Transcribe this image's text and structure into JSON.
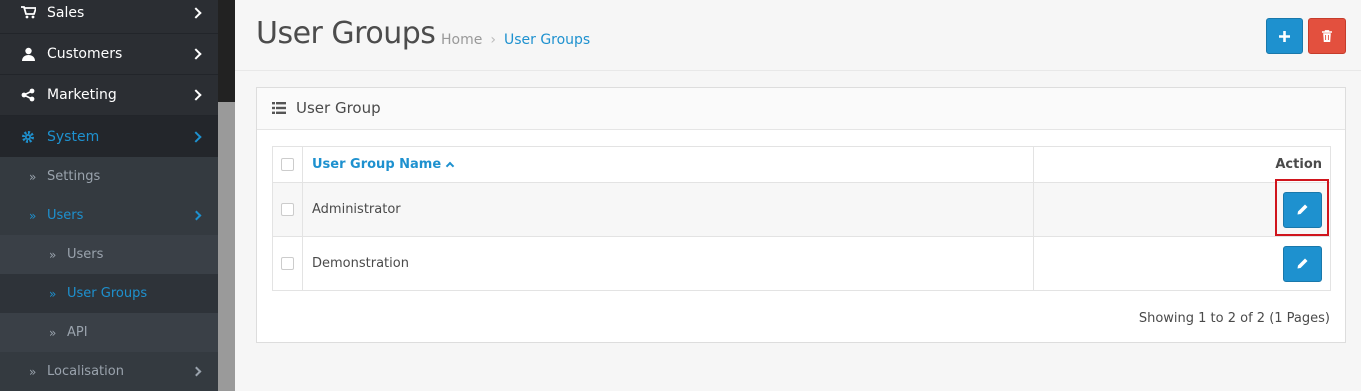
{
  "sidebar": {
    "items": [
      {
        "label": "Sales",
        "icon": "cart-icon"
      },
      {
        "label": "Customers",
        "icon": "user-icon"
      },
      {
        "label": "Marketing",
        "icon": "share-icon"
      },
      {
        "label": "System",
        "icon": "gear-icon"
      }
    ],
    "system_children": [
      {
        "label": "Settings"
      },
      {
        "label": "Users"
      },
      {
        "label": "Localisation"
      }
    ],
    "users_children": [
      {
        "label": "Users"
      },
      {
        "label": "User Groups"
      },
      {
        "label": "API"
      }
    ]
  },
  "header": {
    "title": "User Groups",
    "breadcrumb": [
      "Home",
      "User Groups"
    ],
    "add_icon": "plus-icon",
    "delete_icon": "trash-icon"
  },
  "panel": {
    "title": "User Group",
    "columns": {
      "name": "User Group Name",
      "action": "Action"
    },
    "rows": [
      {
        "name": "Administrator"
      },
      {
        "name": "Demonstration"
      }
    ],
    "paging": "Showing 1 to 2 of 2 (1 Pages)"
  },
  "colors": {
    "accent": "#1e91cf",
    "danger": "#e3503e",
    "sidebar_bg": "#2b2e33",
    "highlight": "#d0151d"
  }
}
